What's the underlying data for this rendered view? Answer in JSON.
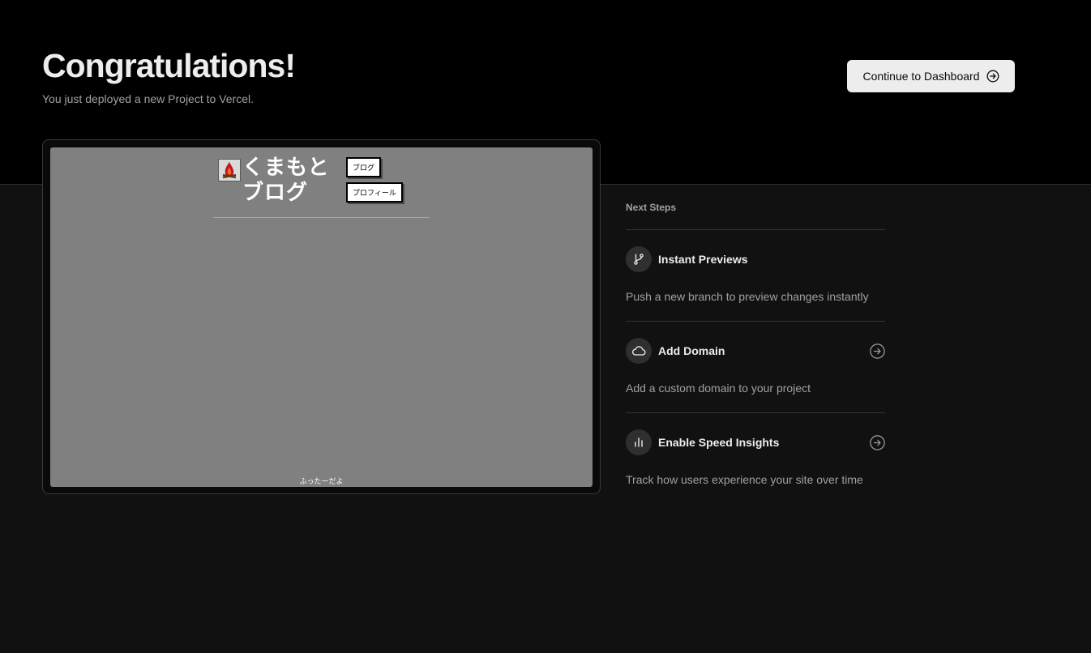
{
  "header": {
    "title": "Congratulations!",
    "subtitle": "You just deployed a new Project to Vercel.",
    "continue_label": "Continue to Dashboard",
    "continue_icon": "arrow-right-circle-icon"
  },
  "preview": {
    "site_logo_icon": "campfire-icon",
    "site_title": "くまもとブログ",
    "nav_blog": "ブログ",
    "nav_profile": "プロフィール",
    "footer": "ふったーだよ"
  },
  "next_steps": {
    "heading": "Next Steps",
    "items": [
      {
        "title": "Instant Previews",
        "description": "Push a new branch to preview changes instantly",
        "icon": "git-branch-icon"
      },
      {
        "title": "Add Domain",
        "description": "Add a custom domain to your project",
        "icon": "cloud-icon",
        "action_icon": "arrow-right-circle-icon"
      },
      {
        "title": "Enable Speed Insights",
        "description": "Track how users experience your site over time",
        "icon": "bar-chart-icon",
        "action_icon": "arrow-right-circle-icon"
      }
    ]
  },
  "colors": {
    "hero_bg": "#000000",
    "page_bg": "#111111",
    "button_bg": "#ededed",
    "preview_bg": "#808080",
    "muted_text": "#a1a1a1"
  }
}
